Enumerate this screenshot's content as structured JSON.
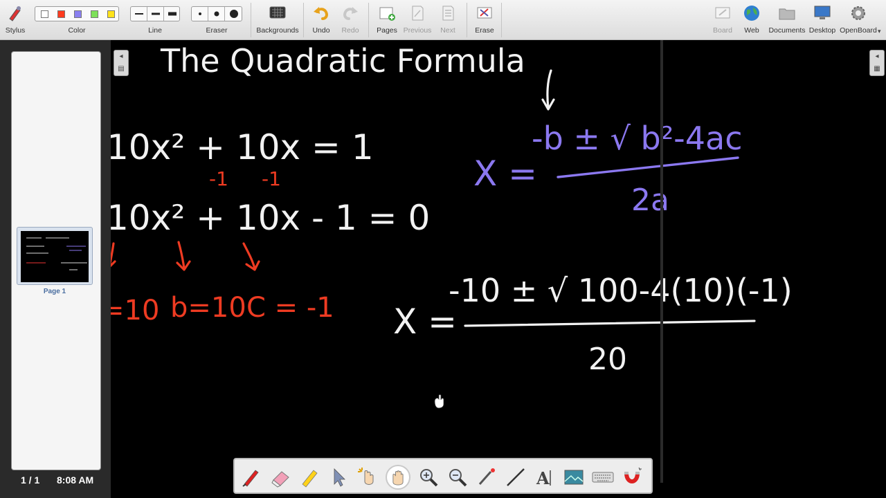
{
  "toolbar": {
    "stylus": "Stylus",
    "color": "Color",
    "line": "Line",
    "eraser": "Eraser",
    "backgrounds": "Backgrounds",
    "undo": "Undo",
    "redo": "Redo",
    "pages": "Pages",
    "previous": "Previous",
    "next": "Next",
    "erase": "Erase",
    "board": "Board",
    "web": "Web",
    "documents": "Documents",
    "desktop": "Desktop",
    "openboard": "OpenBoard"
  },
  "colors": {
    "swatches": [
      "#ffffff",
      "#ff3b1f",
      "#8a80f0",
      "#7ee05a",
      "#ffe21a"
    ],
    "ink_white": "#f2f2f2",
    "ink_purple": "#8b78f0",
    "ink_red": "#ee3b22"
  },
  "sidebar": {
    "thumbnail_label": "Page 1",
    "page_count": "1 / 1",
    "time": "8:08 AM"
  },
  "board": {
    "title": "The Quadratic Formula",
    "equation_1": "10x² + 10x = 1",
    "minus_1a": "-1",
    "minus_1b": "-1",
    "equation_2": "10x² + 10x - 1 = 0",
    "coef_a": "=10",
    "coef_b": "b=10",
    "coef_c": "C = -1",
    "formula_lhs": "X =",
    "formula_num": "-b ± √ b²-4ac",
    "formula_den": "2a",
    "sub_lhs": "X =",
    "sub_num": "-10 ± √ 100-4(10)(-1)",
    "sub_den": "20"
  },
  "floating_tools": [
    "pen-icon",
    "eraser-icon",
    "marker-icon",
    "selector-icon",
    "interact-icon",
    "hand-icon",
    "zoom-in-icon",
    "zoom-out-icon",
    "laser-pointer-icon",
    "line-icon",
    "text-icon",
    "capture-icon",
    "keyboard-icon",
    "magnet-icon"
  ]
}
